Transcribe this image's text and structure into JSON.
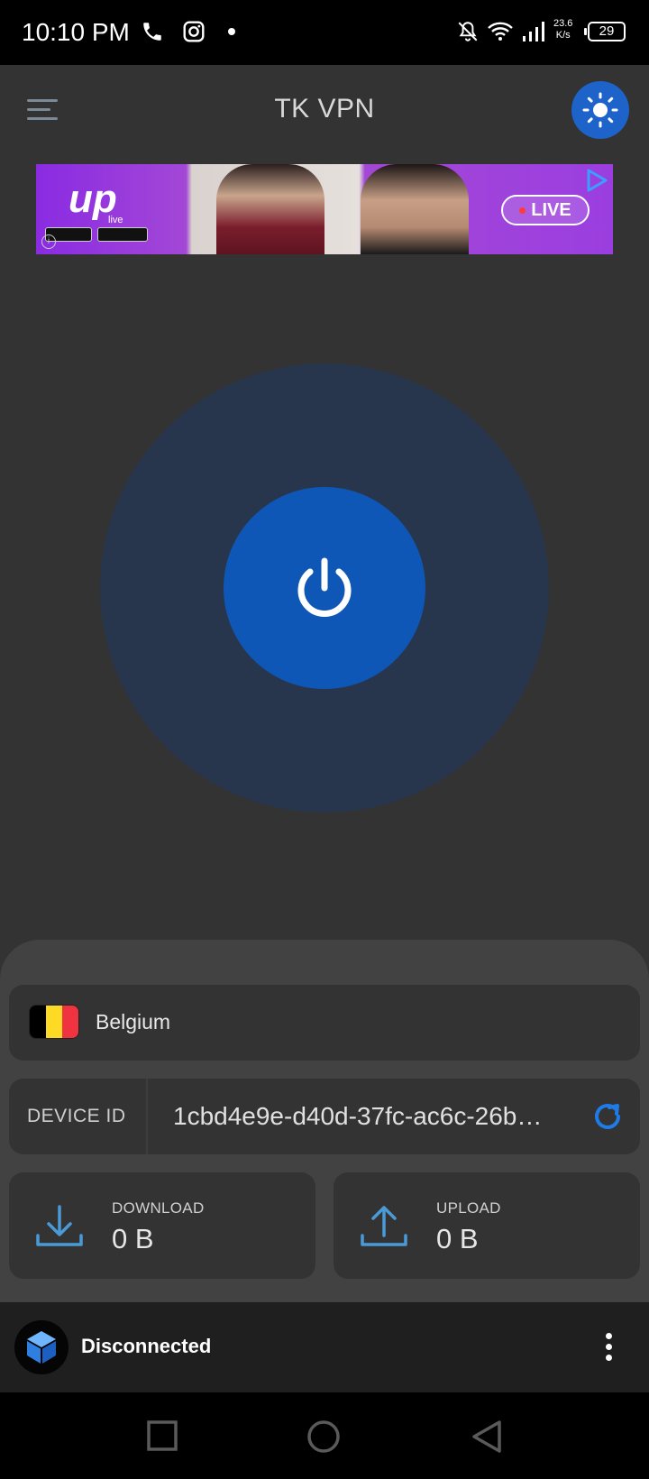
{
  "status_bar": {
    "time": "10:10 PM",
    "speed_value": "23.6",
    "speed_unit": "K/s",
    "battery": "29",
    "icons": [
      "phone-icon",
      "instagram-icon",
      "dot-icon",
      "bell-off-icon",
      "wifi-icon",
      "signal-icon"
    ]
  },
  "header": {
    "title": "TK VPN",
    "menu_icon": "hamburger-icon",
    "theme_icon": "sun-icon",
    "accent_color": "#1e63c9"
  },
  "ad": {
    "brand": "up",
    "brand_sub": "live",
    "live_label": "LIVE",
    "stores": [
      "App Store",
      "Google Play"
    ]
  },
  "power": {
    "icon": "power-icon",
    "outer_color": "#27364d",
    "button_color": "#0f57b6"
  },
  "location": {
    "country": "Belgium",
    "flag_colors": [
      "#000000",
      "#fdda24",
      "#ef3340"
    ]
  },
  "device": {
    "label": "DEVICE ID",
    "value": "1cbd4e9e-d40d-37fc-ac6c-26b…",
    "refresh_icon": "refresh-icon"
  },
  "stats": {
    "download": {
      "label": "DOWNLOAD",
      "value": "0 B",
      "icon": "download-icon"
    },
    "upload": {
      "label": "UPLOAD",
      "value": "0 B",
      "icon": "upload-icon"
    }
  },
  "connection": {
    "status": "Disconnected",
    "icon": "cube-logo-icon",
    "more_icon": "more-vertical-icon"
  },
  "nav": {
    "buttons": [
      "recents-square-icon",
      "home-circle-icon",
      "back-triangle-icon"
    ]
  }
}
